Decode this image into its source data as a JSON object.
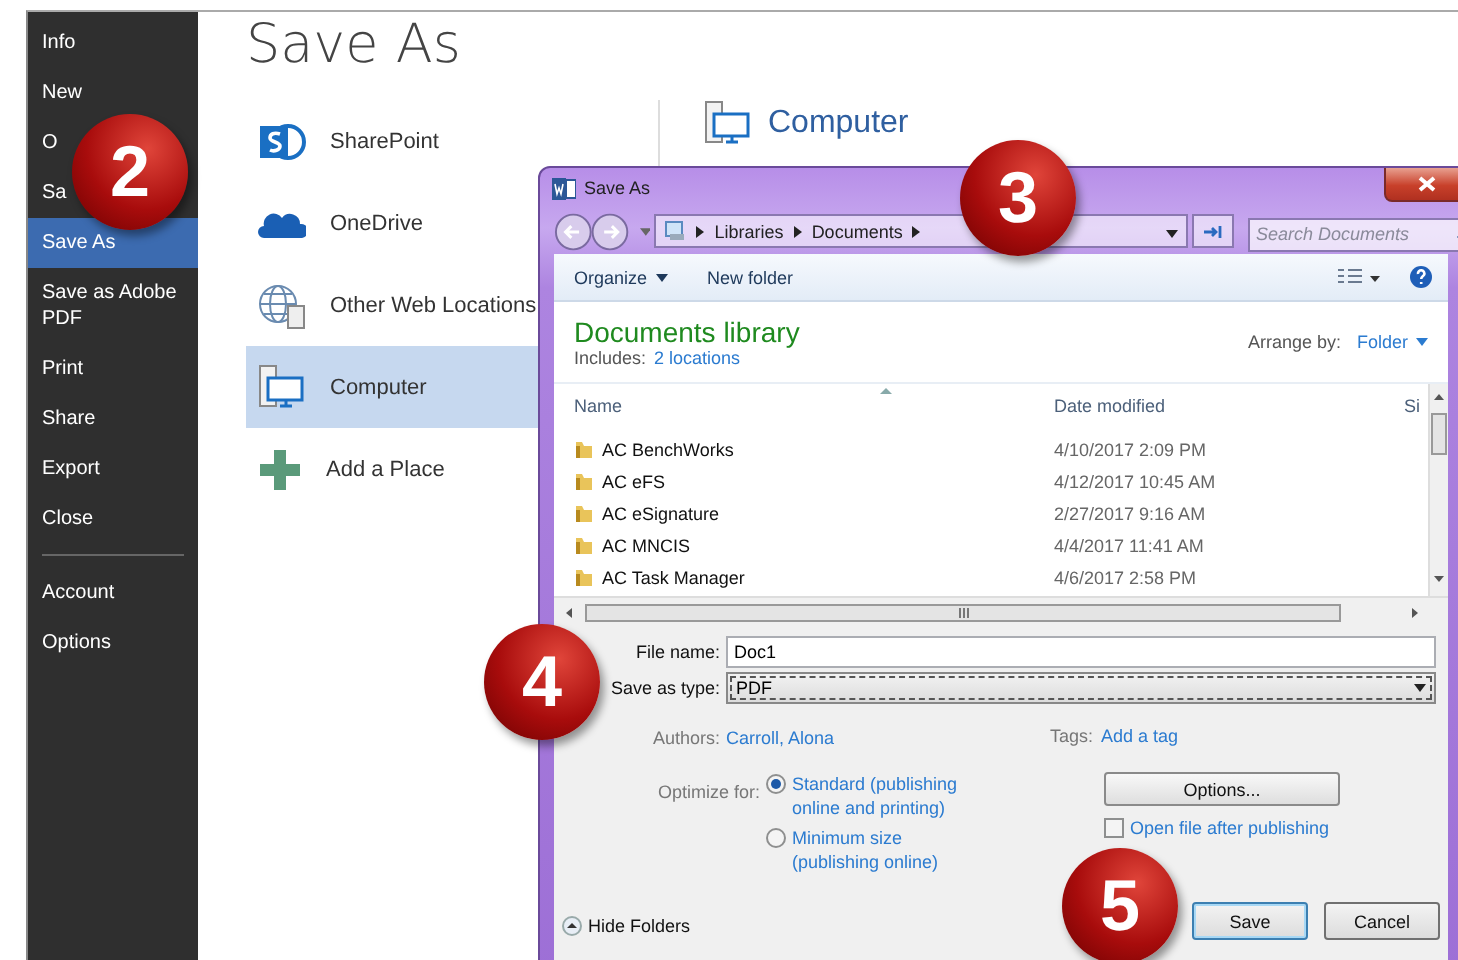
{
  "sidebar": {
    "items": [
      {
        "label": "Info",
        "selected": false
      },
      {
        "label": "New",
        "selected": false
      },
      {
        "label": "O",
        "selected": false
      },
      {
        "label": "Sa",
        "selected": false
      },
      {
        "label": "Save As",
        "selected": true
      },
      {
        "label": "Save as Adobe PDF",
        "selected": false
      },
      {
        "label": "Print",
        "selected": false
      },
      {
        "label": "Share",
        "selected": false
      },
      {
        "label": "Export",
        "selected": false
      },
      {
        "label": "Close",
        "selected": false
      }
    ],
    "bottom_items": [
      {
        "label": "Account",
        "selected": false
      },
      {
        "label": "Options",
        "selected": false
      }
    ]
  },
  "page_title": "Save As",
  "places": [
    {
      "label": "SharePoint",
      "kind": "sharepoint",
      "selected": false
    },
    {
      "label": "OneDrive",
      "kind": "cloud",
      "selected": false
    },
    {
      "label": "Other Web Locations",
      "kind": "web",
      "selected": false
    },
    {
      "label": "Computer",
      "kind": "computer",
      "selected": true
    },
    {
      "label": "Add a Place",
      "kind": "add",
      "selected": false
    }
  ],
  "location_heading": "Computer",
  "dialog": {
    "title": "Save As",
    "breadcrumb": [
      "Libraries",
      "Documents"
    ],
    "search": {
      "placeholder": "Search Documents"
    },
    "toolbar": [
      "Organize",
      "New folder"
    ],
    "library": {
      "title": "Documents library",
      "includes_label": "Includes:",
      "includes_link": "2 locations",
      "arrange_label": "Arrange by:",
      "arrange_value": "Folder"
    },
    "columns": [
      "Name",
      "Date modified",
      "Si"
    ],
    "rows": [
      {
        "name": "AC BenchWorks",
        "date": "4/10/2017 2:09 PM"
      },
      {
        "name": "AC eFS",
        "date": "4/12/2017 10:45 AM"
      },
      {
        "name": "AC eSignature",
        "date": "2/27/2017 9:16 AM"
      },
      {
        "name": "AC MNCIS",
        "date": "4/4/2017 11:41 AM"
      },
      {
        "name": "AC Task Manager",
        "date": "4/6/2017 2:58 PM"
      }
    ],
    "file_name_label": "File name:",
    "file_name": "Doc1",
    "save_type_label": "Save as type:",
    "save_type": "PDF",
    "authors_label": "Authors:",
    "authors": "Carroll, Alona",
    "tags_label": "Tags:",
    "tags": "Add a tag",
    "optimize_label": "Optimize for:",
    "optimize_options": [
      {
        "label": "Standard (publishing online and printing)",
        "selected": true
      },
      {
        "label": "Minimum size (publishing online)",
        "selected": false
      }
    ],
    "options_button": "Options...",
    "open_after": {
      "label": "Open file after publishing",
      "checked": false
    },
    "hide_folders": "Hide Folders",
    "buttons": [
      {
        "label": "Save",
        "default": true
      },
      {
        "label": "Cancel",
        "default": false
      }
    ]
  },
  "badges": [
    "2",
    "3",
    "4",
    "5"
  ]
}
